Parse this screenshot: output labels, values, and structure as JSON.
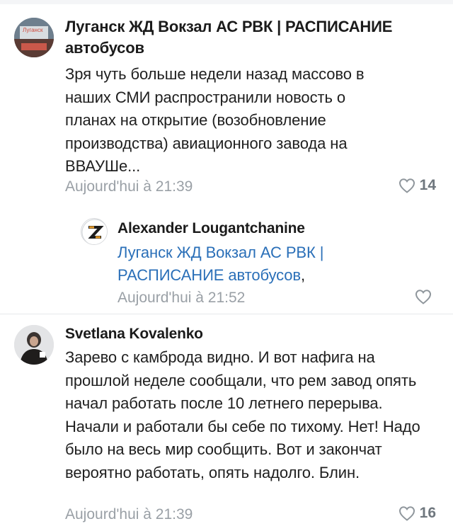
{
  "comments": [
    {
      "author": "Луганск ЖД Вокзал АС РВК | РАСПИСАНИЕ автобусов",
      "avatar_text": "Луганск",
      "text": "Зря чуть больше недели назад массово в наших СМИ распространили новость о планах на открытие (возобновление производства) авиационного завода на ВВАУШе...",
      "time": "Aujourd'hui à 21:39",
      "likes": "14"
    },
    {
      "author": "Alexander Lougantchanine",
      "avatar_text": "Z",
      "mention": "Луганск ЖД Вокзал АС РВК | РАСПИСАНИЕ автобусов",
      "text_suffix": ",",
      "time": "Aujourd'hui à 21:52",
      "likes": ""
    },
    {
      "author": "Svetlana Kovalenko",
      "text": "Зарево с камброда видно. И вот нафига на прошлой неделе сообщали, что рем завод опять начал работать после 10 летнего перерыва. Начали и работали бы себе по тихому. Нет! Надо было на весь мир сообщить. Вот и закончат вероятно работать, опять надолго. Блин.",
      "time": "Aujourd'hui à 21:39",
      "likes": "16"
    }
  ],
  "icons": {
    "like": "heart-outline-icon"
  },
  "colors": {
    "link": "#2a6fb8",
    "meta": "#9aa0a6",
    "text": "#1f1f1f"
  }
}
